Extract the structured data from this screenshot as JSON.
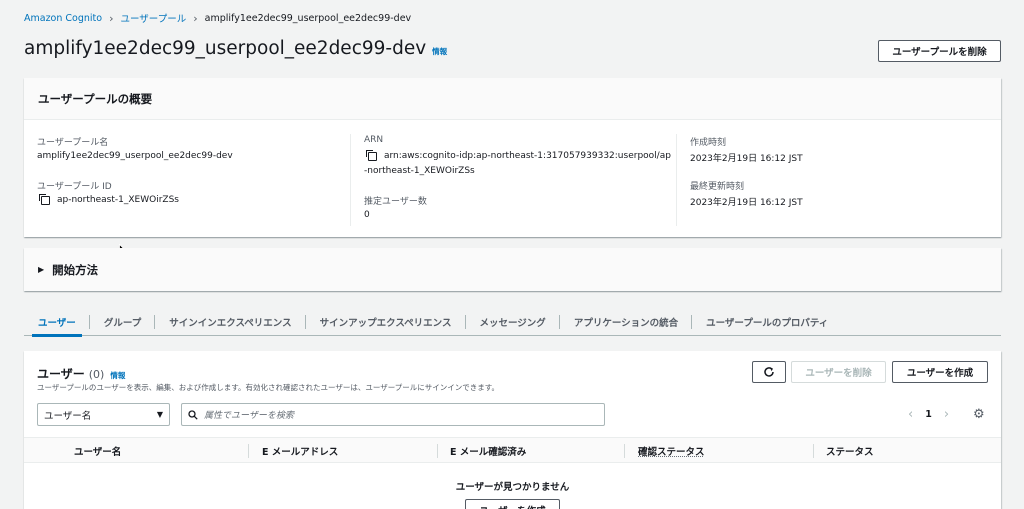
{
  "breadcrumb": {
    "items": [
      "Amazon Cognito",
      "ユーザープール"
    ],
    "current": "amplify1ee2dec99_userpool_ee2dec99-dev"
  },
  "header": {
    "title": "amplify1ee2dec99_userpool_ee2dec99-dev",
    "info": "情報",
    "delete_button": "ユーザープールを削除"
  },
  "overview": {
    "heading": "ユーザープールの概要",
    "pool_name_label": "ユーザープール名",
    "pool_name": "amplify1ee2dec99_userpool_ee2dec99-dev",
    "pool_id_label": "ユーザープール ID",
    "pool_id": "ap-northeast-1_XEWOirZSs",
    "arn_label": "ARN",
    "arn_line1": "arn:aws:cognito-idp:ap-northeast-1:317057939332:userpool/ap",
    "arn_line2": "-northeast-1_XEWOirZSs",
    "est_users_label": "推定ユーザー数",
    "est_users": "0",
    "created_label": "作成時刻",
    "created": "2023年2月19日 16:12 JST",
    "modified_label": "最終更新時刻",
    "modified": "2023年2月19日 16:12 JST"
  },
  "getting_started": {
    "label": "開始方法"
  },
  "tabs": [
    {
      "label": "ユーザー"
    },
    {
      "label": "グループ"
    },
    {
      "label": "サインインエクスペリエンス"
    },
    {
      "label": "サインアップエクスペリエンス"
    },
    {
      "label": "メッセージング"
    },
    {
      "label": "アプリケーションの統合"
    },
    {
      "label": "ユーザープールのプロパティ"
    }
  ],
  "users": {
    "title": "ユーザー",
    "count": "(0)",
    "info": "情報",
    "description": "ユーザープールのユーザーを表示、編集、および作成します。有効化され確認されたユーザーは、ユーザープールにサインインできます。",
    "delete_button": "ユーザーを削除",
    "create_button": "ユーザーを作成",
    "filter_select": "ユーザー名",
    "search_placeholder": "属性でユーザーを検索",
    "page": "1",
    "columns": [
      "ユーザー名",
      "E メールアドレス",
      "E メール確認済み",
      "確認ステータス",
      "ステータス"
    ],
    "empty_text": "ユーザーが見つかりません",
    "empty_create_button": "ユーザーを作成"
  },
  "colors": {
    "accent": "#0073bb",
    "background": "#f2f3f3"
  }
}
